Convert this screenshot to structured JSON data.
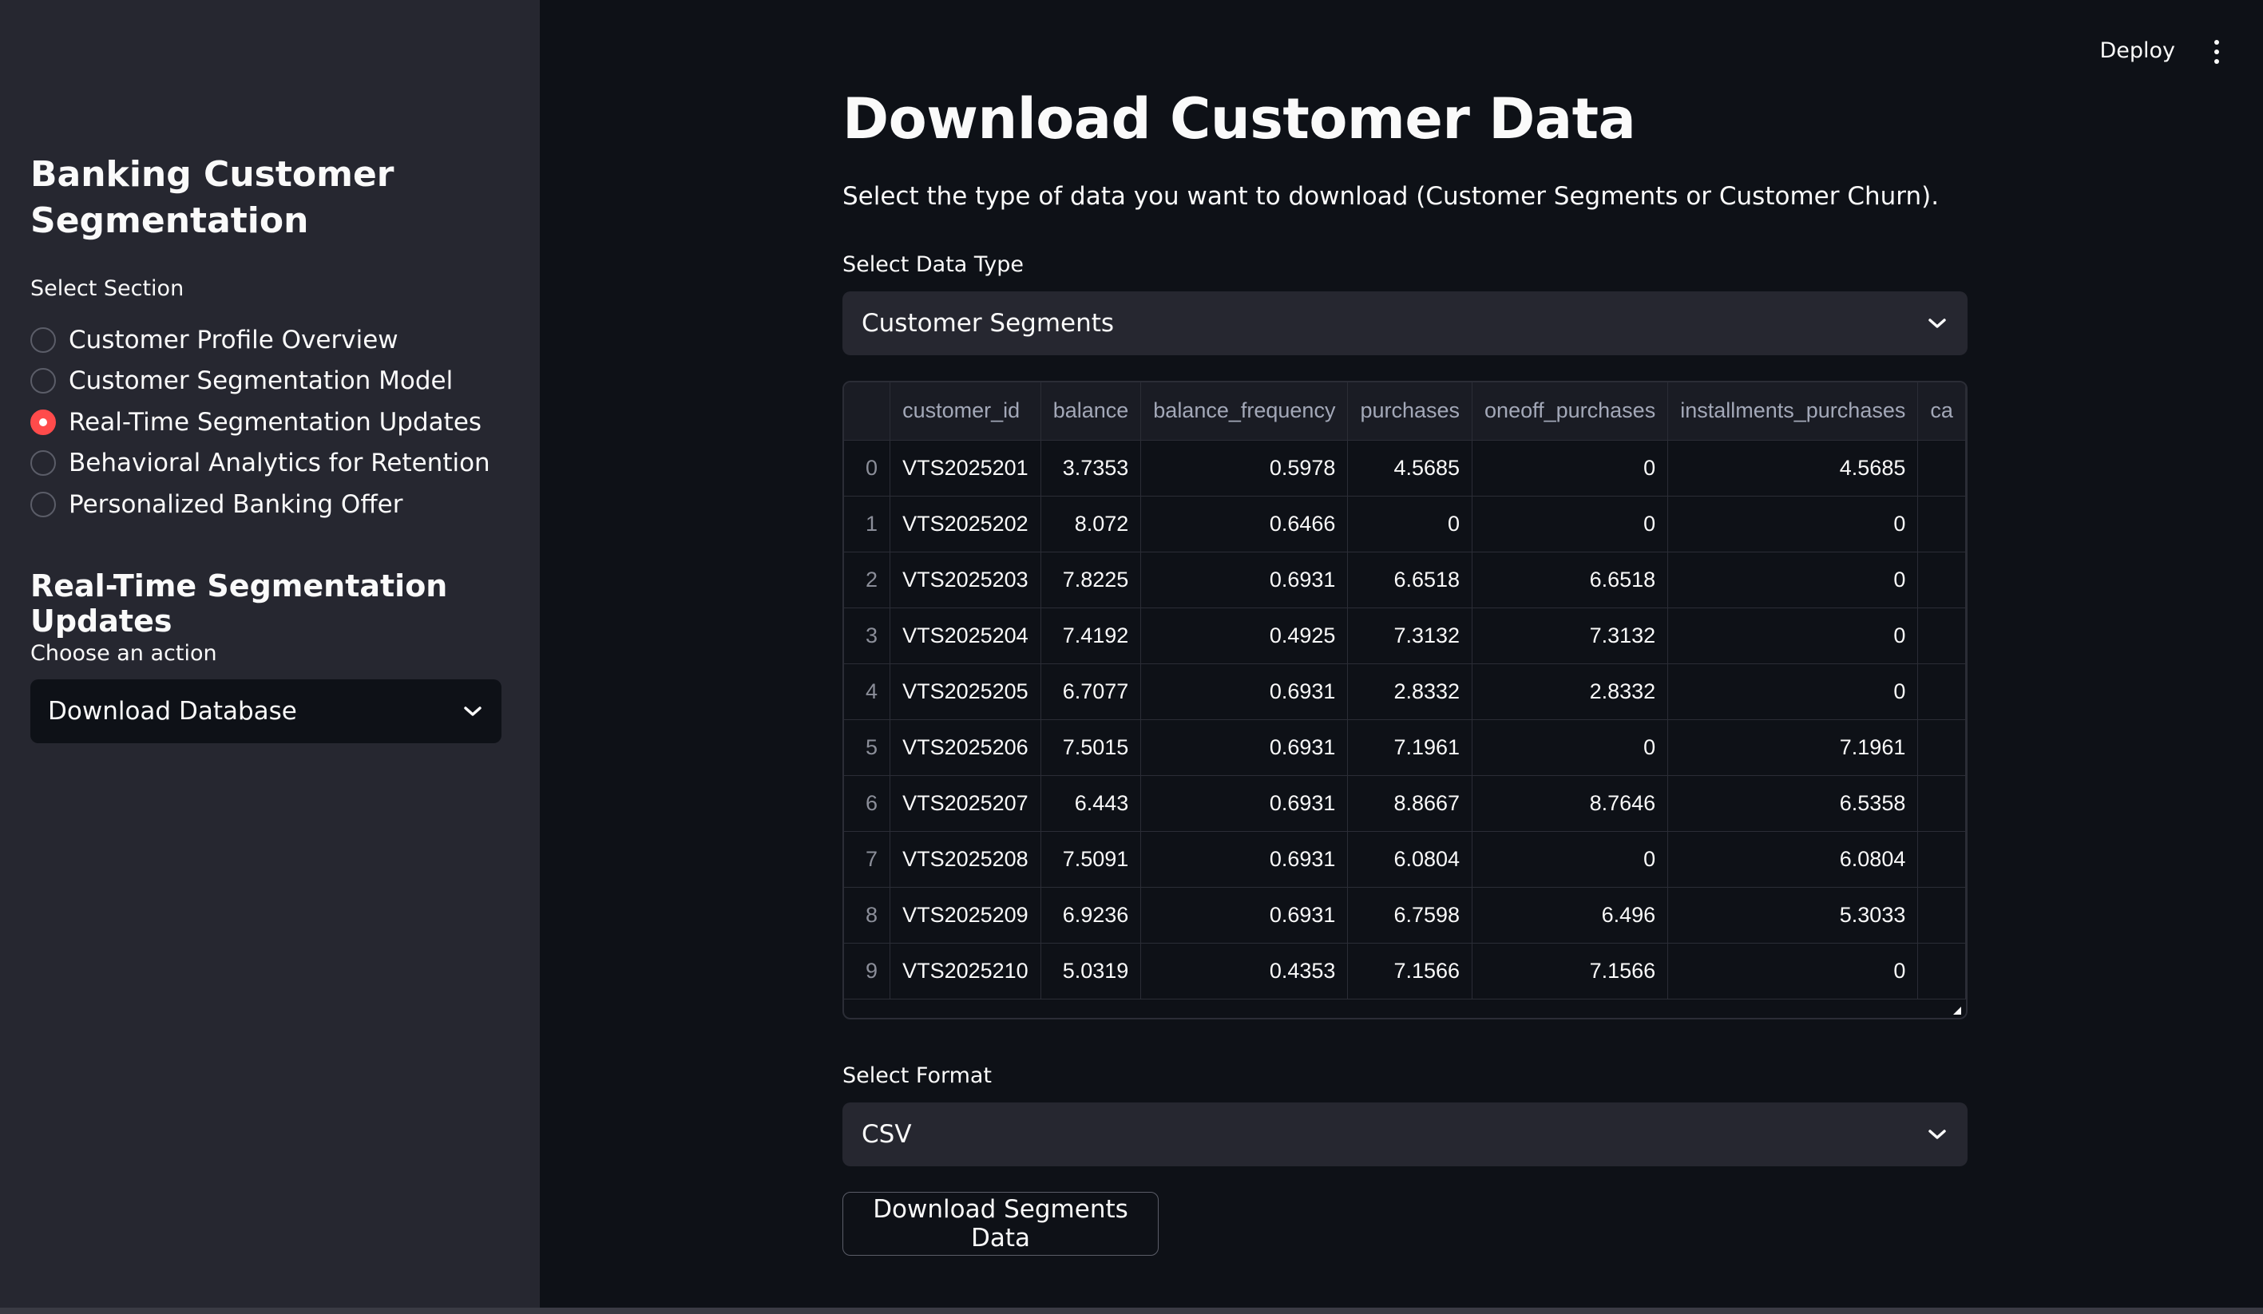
{
  "header": {
    "deploy_label": "Deploy"
  },
  "sidebar": {
    "title": "Banking Customer Segmentation",
    "section_label": "Select Section",
    "sections": [
      {
        "label": "Customer Profile Overview",
        "checked": false
      },
      {
        "label": "Customer Segmentation Model",
        "checked": false
      },
      {
        "label": "Real-Time Segmentation Updates",
        "checked": true
      },
      {
        "label": "Behavioral Analytics for Retention",
        "checked": false
      },
      {
        "label": "Personalized Banking Offer",
        "checked": false
      }
    ],
    "subheader": "Real-Time Segmentation Updates",
    "action_label": "Choose an action",
    "action_value": "Download Database"
  },
  "main": {
    "title": "Download Customer Data",
    "description": "Select the type of data you want to download (Customer Segments or Customer Churn).",
    "data_type_label": "Select Data Type",
    "data_type_value": "Customer Segments",
    "format_label": "Select Format",
    "format_value": "CSV",
    "download_button": "Download Segments Data"
  },
  "table": {
    "columns": [
      "",
      "customer_id",
      "balance",
      "balance_frequency",
      "purchases",
      "oneoff_purchases",
      "installments_purchases",
      "ca"
    ],
    "rows": [
      [
        "0",
        "VTS2025201",
        "3.7353",
        "0.5978",
        "4.5685",
        "0",
        "4.5685",
        ""
      ],
      [
        "1",
        "VTS2025202",
        "8.072",
        "0.6466",
        "0",
        "0",
        "0",
        ""
      ],
      [
        "2",
        "VTS2025203",
        "7.8225",
        "0.6931",
        "6.6518",
        "6.6518",
        "0",
        ""
      ],
      [
        "3",
        "VTS2025204",
        "7.4192",
        "0.4925",
        "7.3132",
        "7.3132",
        "0",
        ""
      ],
      [
        "4",
        "VTS2025205",
        "6.7077",
        "0.6931",
        "2.8332",
        "2.8332",
        "0",
        ""
      ],
      [
        "5",
        "VTS2025206",
        "7.5015",
        "0.6931",
        "7.1961",
        "0",
        "7.1961",
        ""
      ],
      [
        "6",
        "VTS2025207",
        "6.443",
        "0.6931",
        "8.8667",
        "8.7646",
        "6.5358",
        ""
      ],
      [
        "7",
        "VTS2025208",
        "7.5091",
        "0.6931",
        "6.0804",
        "0",
        "6.0804",
        ""
      ],
      [
        "8",
        "VTS2025209",
        "6.9236",
        "0.6931",
        "6.7598",
        "6.496",
        "5.3033",
        ""
      ],
      [
        "9",
        "VTS2025210",
        "5.0319",
        "0.4353",
        "7.1566",
        "7.1566",
        "0",
        ""
      ]
    ]
  },
  "colors": {
    "accent": "#ff4b4b",
    "sidebar_bg": "#262730",
    "main_bg": "#0e1117"
  },
  "icons": {
    "select_chevron": "chevron-down-icon",
    "menu": "kebab-menu-icon",
    "radio_checked": "radio-checked-icon"
  }
}
